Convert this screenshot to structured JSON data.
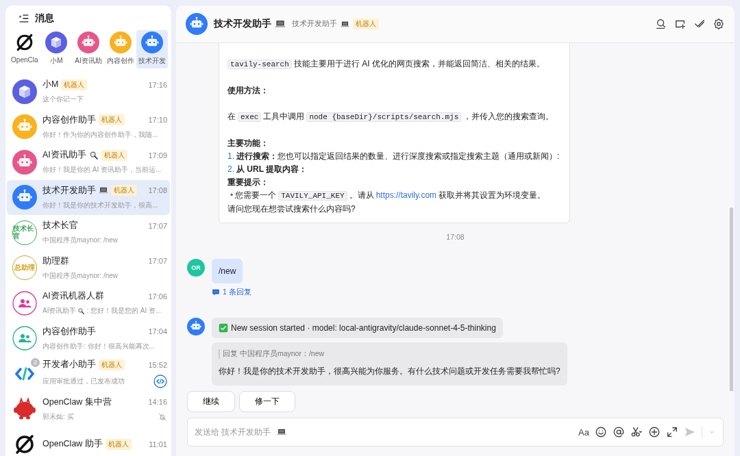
{
  "sidebar": {
    "title": "消息",
    "pinned": [
      {
        "label": "OpenCla",
        "selected": false,
        "avatar": {
          "kind": "ring"
        }
      },
      {
        "label": "小M",
        "selected": false,
        "avatar": {
          "kind": "cube",
          "color": "#5b5fe0"
        }
      },
      {
        "label": "AI资讯助",
        "selected": false,
        "avatar": {
          "kind": "robot",
          "color": "#e5578a"
        }
      },
      {
        "label": "内容创作",
        "selected": false,
        "avatar": {
          "kind": "robot",
          "color": "#f9b21d"
        }
      },
      {
        "label": "技术开发",
        "selected": true,
        "avatar": {
          "kind": "robot",
          "color": "#2f7cf6"
        }
      }
    ],
    "conversations": [
      {
        "name": "小M",
        "tag": "机器人",
        "time": "17:16",
        "preview": "这个你记一下",
        "selected": false,
        "avatar": {
          "kind": "cube",
          "color": "#5b5fe0"
        }
      },
      {
        "name": "内容创作助手",
        "tag": "机器人",
        "time": "17:10",
        "preview": "你好！作为你的内容创作助手，我随...",
        "selected": false,
        "avatar": {
          "kind": "robot",
          "color": "#f9b21d"
        }
      },
      {
        "name": "AI资讯助手",
        "name_icon": {
          "kind": "magnifier"
        },
        "tag": "机器人",
        "time": "17:09",
        "preview": "你好！我是你的 AI 资讯助手，当前运...",
        "selected": false,
        "avatar": {
          "kind": "robot",
          "color": "#e5578a"
        }
      },
      {
        "name": "技术开发助手",
        "name_icon": {
          "kind": "laptop"
        },
        "tag": "机器人",
        "time": "17:08",
        "preview": "你好！我是你的技术开发助手，很高...",
        "selected": true,
        "avatar": {
          "kind": "robot",
          "color": "#2f7cf6"
        }
      },
      {
        "name": "技术长官",
        "time": "17:07",
        "preview": "中国程序员maynor: /new",
        "selected": false,
        "avatar": {
          "kind": "text",
          "text": "技术长官",
          "color": "#3aa655"
        }
      },
      {
        "name": "助理群",
        "time": "17:07",
        "preview": "中国程序员maynor: /new",
        "selected": false,
        "avatar": {
          "kind": "text",
          "text": "总助理",
          "color": "#d4a017"
        }
      },
      {
        "name": "AI资讯机器人群",
        "time": "17:06",
        "preview": "AI资讯助手",
        "preview_icon": {
          "kind": "magnifier"
        },
        "preview_rest": ": 您好！我是您的 AI 资...",
        "selected": false,
        "avatar": {
          "kind": "group",
          "color": "#e0359a"
        }
      },
      {
        "name": "内容创作助手",
        "time": "17:04",
        "preview": "内容创作助手: 你好！很高兴能再次...",
        "selected": false,
        "avatar": {
          "kind": "group",
          "color": "#1fb594"
        }
      },
      {
        "name": "开发者小助手",
        "tag": "机器人",
        "time": "15:52",
        "preview": "应用审批通过，已发布成功",
        "selected": false,
        "badge": "2",
        "trailing": {
          "kind": "code"
        },
        "avatar": {
          "kind": "code"
        }
      },
      {
        "name": "OpenClaw 集中营",
        "time": "14:16",
        "preview": "郭禾灿: 买",
        "selected": false,
        "trailing": {
          "kind": "muted"
        },
        "avatar": {
          "kind": "mascot",
          "color": "#d92b2b"
        }
      },
      {
        "name": "OpenClaw 助手",
        "tag": "机器人",
        "time": "11:01",
        "selected": false,
        "avatar": {
          "kind": "ring"
        }
      }
    ]
  },
  "chat": {
    "header": {
      "title": "技术开发助手",
      "title_icon": {
        "kind": "laptop"
      },
      "subtitle": "技术开发助手",
      "subtitle_icon": {
        "kind": "laptop"
      },
      "tag": "机器人",
      "avatar": {
        "kind": "robot",
        "color": "#2f7cf6"
      },
      "tools": [
        {
          "kind": "search"
        },
        {
          "kind": "add-screen"
        },
        {
          "kind": "tick"
        },
        {
          "kind": "settings"
        }
      ]
    },
    "messages": [
      {
        "kind": "card",
        "blocks": [
          {
            "kind": "p",
            "parts": [
              {
                "kind": "code",
                "text": "tavily-search"
              },
              {
                "kind": "text",
                "text": "技能主要用于进行 AI 优化的网页搜索，并能返回简洁、相关的结果。"
              }
            ]
          },
          {
            "kind": "heading",
            "text": "使用方法："
          },
          {
            "kind": "p",
            "parts": [
              {
                "kind": "text",
                "text": "在"
              },
              {
                "kind": "code",
                "text": "exec"
              },
              {
                "kind": "text",
                "text": "工具中调用"
              },
              {
                "kind": "code",
                "text": "node {baseDir}/scripts/search.mjs"
              },
              {
                "kind": "text",
                "text": "，并传入您的搜索查询。"
              }
            ]
          },
          {
            "kind": "heading",
            "text": "主要功能："
          },
          {
            "kind": "ol",
            "marker": "1.",
            "text": "**进行搜索：**您也可以指定返回结果的数量、进行深度搜索或指定搜索主题（通用或新闻）:"
          },
          {
            "kind": "ol",
            "marker": "2.",
            "text": "**从 URL 提取内容：**"
          },
          {
            "kind": "heading",
            "text": "重要提示："
          },
          {
            "kind": "ul",
            "marker": "•",
            "parts": [
              {
                "kind": "text",
                "text": "您需要一个"
              },
              {
                "kind": "code",
                "text": "TAVILY_API_KEY"
              },
              {
                "kind": "text",
                "text": "。请从"
              },
              {
                "kind": "link",
                "text": "https://tavily.com"
              },
              {
                "kind": "text",
                "text": "获取并将其设置为环境变量。"
              }
            ]
          },
          {
            "kind": "p",
            "parts": [
              {
                "kind": "text",
                "text": "请问您现在想尝试搜索什么内容吗?"
              }
            ]
          }
        ]
      },
      {
        "kind": "time",
        "text": "17:08"
      },
      {
        "kind": "user",
        "avatar": {
          "kind": "initials",
          "text": "OR",
          "color": "#1ec6a0"
        },
        "text": "/new",
        "replies": "1 条回复"
      },
      {
        "kind": "bot",
        "avatar": {
          "kind": "robot",
          "color": "#2f7cf6"
        },
        "status": "New session started · model: local-antigravity/claude-sonnet-4-5-thinking",
        "quote": "回复 中国程序员maynor：/new",
        "text": "你好！我是你的技术开发助手，很高兴能为你服务。有什么技术问题或开发任务需要我帮忙吗?"
      }
    ],
    "quick_replies": [
      "继续",
      "修一下"
    ],
    "composer": {
      "placeholder": "发送给 技术开发助手",
      "placeholder_icon": {
        "kind": "laptop"
      },
      "tools": [
        {
          "kind": "text",
          "label": "Aa"
        },
        {
          "kind": "emoji"
        },
        {
          "kind": "at"
        },
        {
          "kind": "scissors"
        },
        {
          "kind": "plus"
        },
        {
          "kind": "expand"
        }
      ]
    }
  }
}
